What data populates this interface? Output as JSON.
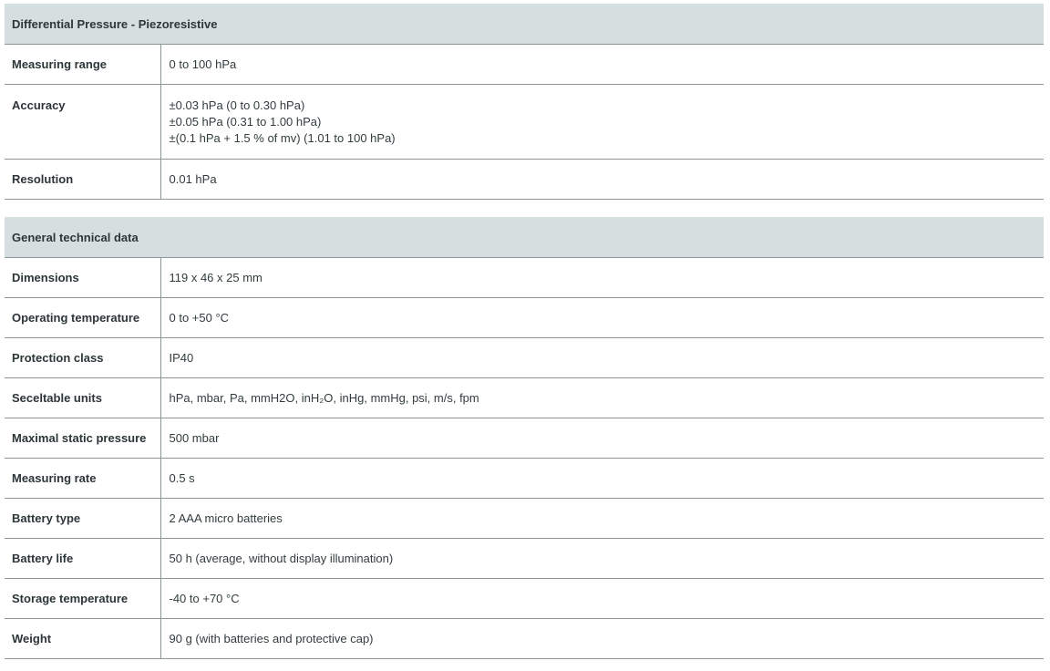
{
  "sections": [
    {
      "title": "Differential Pressure - Piezoresistive",
      "rows": [
        {
          "label": "Measuring range",
          "lines": [
            "0 to 100 hPa"
          ]
        },
        {
          "label": "Accuracy",
          "lines": [
            "±0.03 hPa (0 to 0.30 hPa)",
            "±0.05 hPa (0.31 to 1.00 hPa)",
            "±(0.1 hPa + 1.5 % of mv) (1.01 to 100 hPa)"
          ]
        },
        {
          "label": "Resolution",
          "lines": [
            "0.01 hPa"
          ]
        }
      ]
    },
    {
      "title": "General technical data",
      "rows": [
        {
          "label": "Dimensions",
          "lines": [
            "119 x 46 x 25 mm"
          ]
        },
        {
          "label": "Operating temperature",
          "lines": [
            "0 to +50 °C"
          ]
        },
        {
          "label": "Protection class",
          "lines": [
            "IP40"
          ]
        },
        {
          "label": "Seceltable units",
          "lines": [
            "hPa, mbar, Pa, mmH2O, inH₂O, inHg, mmHg, psi, m/s, fpm"
          ]
        },
        {
          "label": "Maximal static pressure",
          "lines": [
            "500 mbar"
          ]
        },
        {
          "label": "Measuring rate",
          "lines": [
            "0.5 s"
          ]
        },
        {
          "label": "Battery type",
          "lines": [
            "2 AAA micro batteries"
          ]
        },
        {
          "label": "Battery life",
          "lines": [
            "50 h (average, without display illumination)"
          ]
        },
        {
          "label": "Storage temperature",
          "lines": [
            "-40 to +70 °C"
          ]
        },
        {
          "label": "Weight",
          "lines": [
            "90 g (with batteries and protective cap)"
          ]
        }
      ]
    }
  ]
}
